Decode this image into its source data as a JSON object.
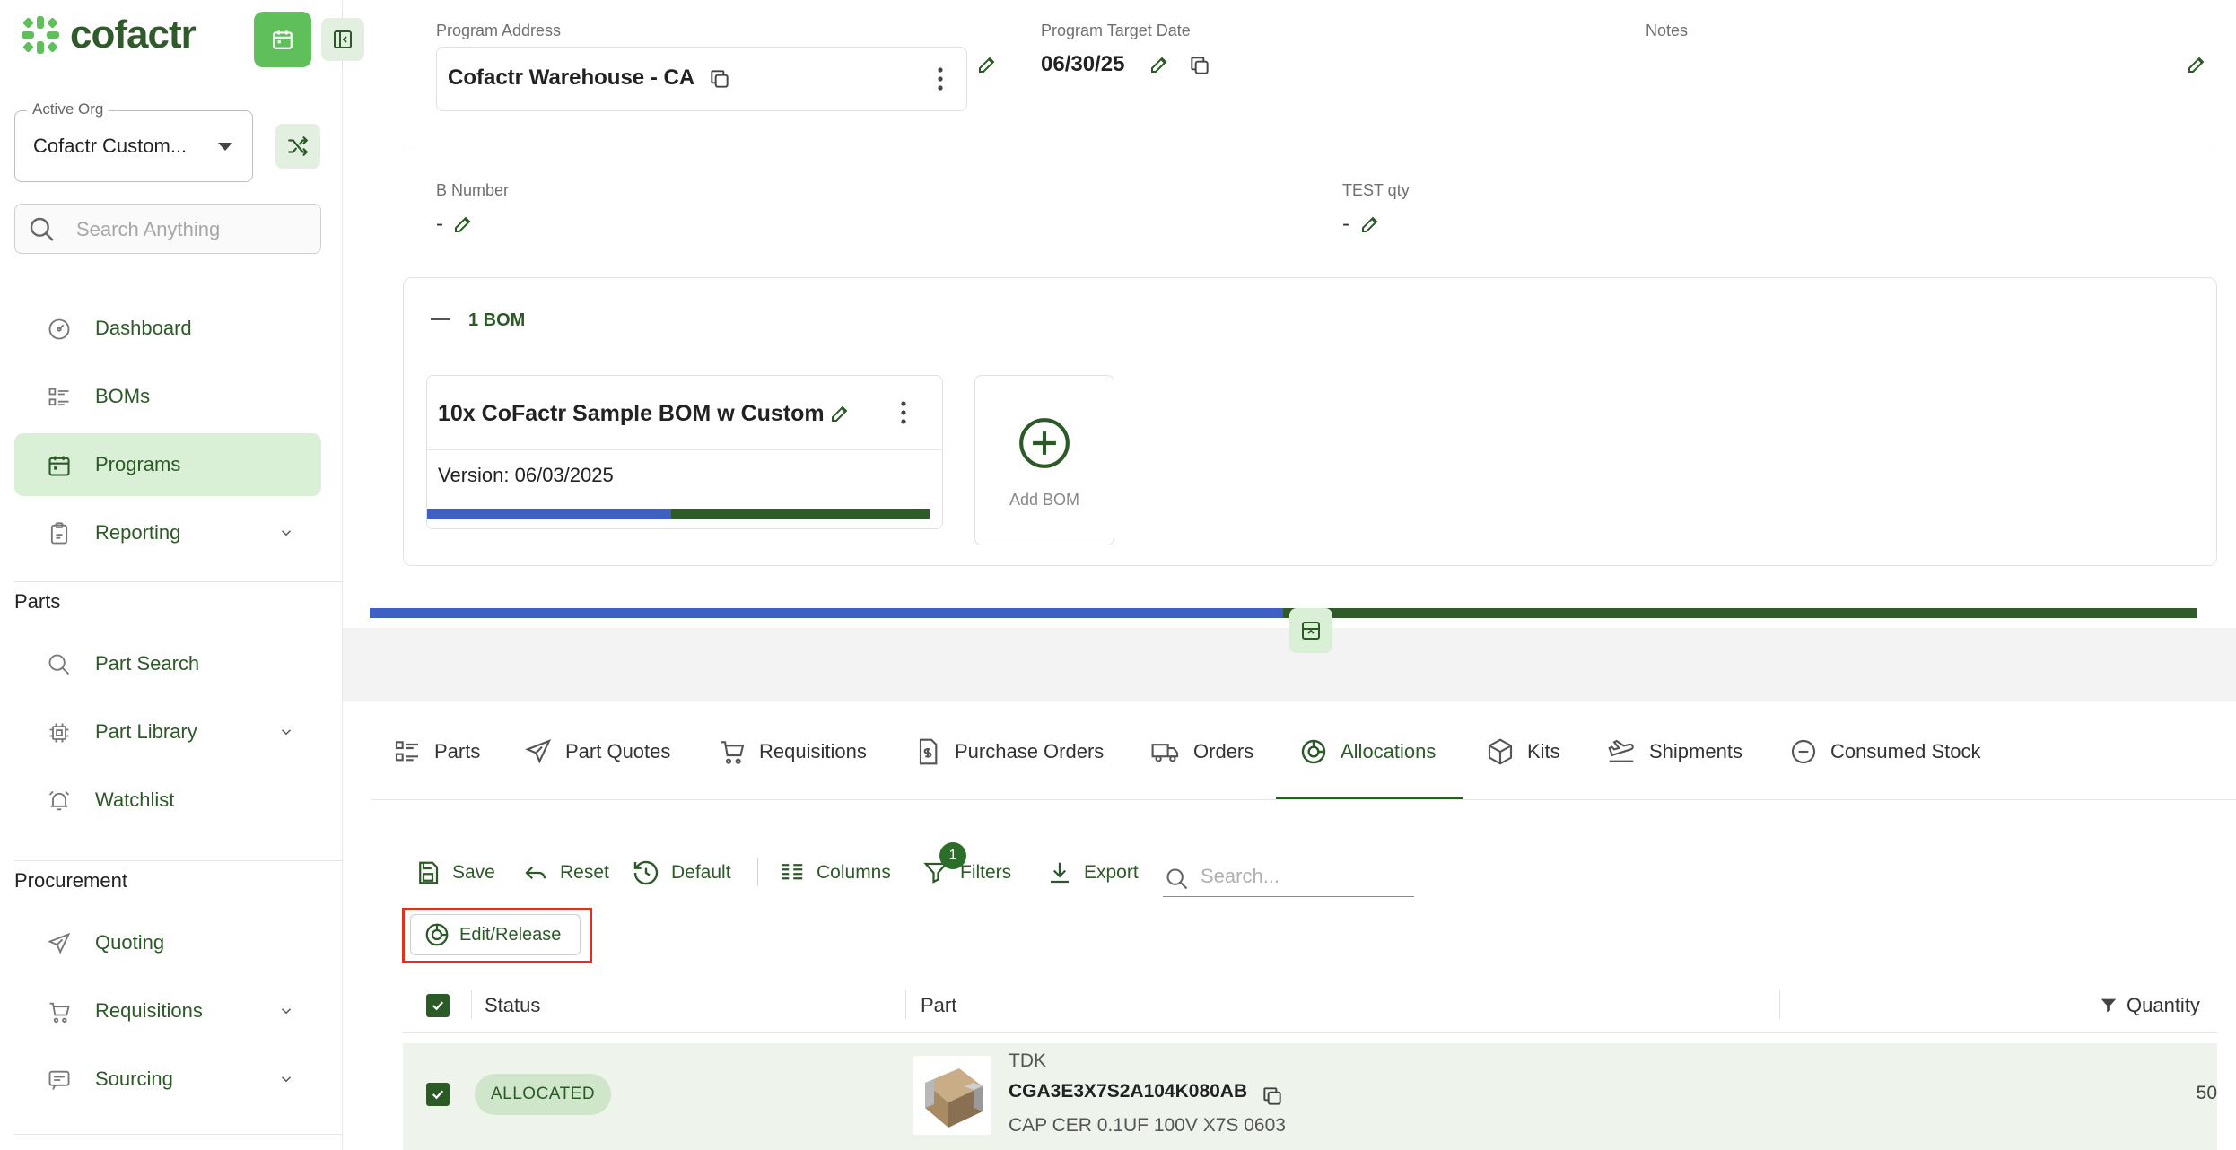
{
  "app": {
    "logo_text": "cofactr"
  },
  "sidebar": {
    "org_label": "Active Org",
    "org_value": "Cofactr Custom...",
    "search_placeholder": "Search Anything",
    "nav": [
      {
        "label": "Dashboard",
        "icon": "dashboard-icon"
      },
      {
        "label": "BOMs",
        "icon": "list-icon"
      },
      {
        "label": "Programs",
        "icon": "calendar-icon",
        "active": true
      },
      {
        "label": "Reporting",
        "icon": "clipboard-icon",
        "expandable": true
      }
    ],
    "parts_title": "Parts",
    "parts": [
      {
        "label": "Part Search",
        "icon": "search-icon"
      },
      {
        "label": "Part Library",
        "icon": "chip-icon",
        "expandable": true
      },
      {
        "label": "Watchlist",
        "icon": "alarm-icon"
      }
    ],
    "procurement_title": "Procurement",
    "procurement": [
      {
        "label": "Quoting",
        "icon": "send-icon"
      },
      {
        "label": "Requisitions",
        "icon": "cart-icon",
        "expandable": true
      },
      {
        "label": "Sourcing",
        "icon": "sourcing-icon",
        "expandable": true
      }
    ]
  },
  "program": {
    "address_label": "Program Address",
    "address_value": "Cofactr Warehouse - CA",
    "target_date_label": "Program Target Date",
    "target_date_value": "06/30/25",
    "notes_label": "Notes",
    "b_number_label": "B Number",
    "b_number_value": "-",
    "test_qty_label": "TEST qty",
    "test_qty_value": "-"
  },
  "bom": {
    "count_label": "1 BOM",
    "card_title": "10x CoFactr Sample BOM w Custom",
    "card_version": "Version: 06/03/2025",
    "card_progress": 0.485,
    "add_label": "Add BOM"
  },
  "overall_progress": 0.5,
  "tabs": [
    {
      "label": "Parts",
      "icon": "parts-list-icon"
    },
    {
      "label": "Part Quotes",
      "icon": "send-icon"
    },
    {
      "label": "Requisitions",
      "icon": "cart-icon"
    },
    {
      "label": "Purchase Orders",
      "icon": "purchase-order-icon"
    },
    {
      "label": "Orders",
      "icon": "truck-icon"
    },
    {
      "label": "Allocations",
      "icon": "pie-icon",
      "active": true
    },
    {
      "label": "Kits",
      "icon": "box-icon"
    },
    {
      "label": "Shipments",
      "icon": "plane-icon"
    },
    {
      "label": "Consumed Stock",
      "icon": "minus-circle-icon"
    }
  ],
  "toolbar": {
    "save": "Save",
    "reset": "Reset",
    "default": "Default",
    "columns": "Columns",
    "filters": "Filters",
    "filters_count": "1",
    "export": "Export",
    "search_placeholder": "Search...",
    "edit_release": "Edit/Release"
  },
  "table": {
    "headers": {
      "status": "Status",
      "part": "Part",
      "quantity": "Quantity"
    },
    "rows": [
      {
        "status": "ALLOCATED",
        "mfr": "TDK",
        "mpn": "CGA3E3X7S2A104K080AB",
        "description": "CAP CER 0.1UF 100V X7S 0603",
        "quantity": "50"
      }
    ]
  },
  "colors": {
    "accent": "#2b5a27",
    "progress_blue": "#3f5fc4",
    "progress_green": "#2f5a2a",
    "active_nav": "#d9efd6"
  }
}
